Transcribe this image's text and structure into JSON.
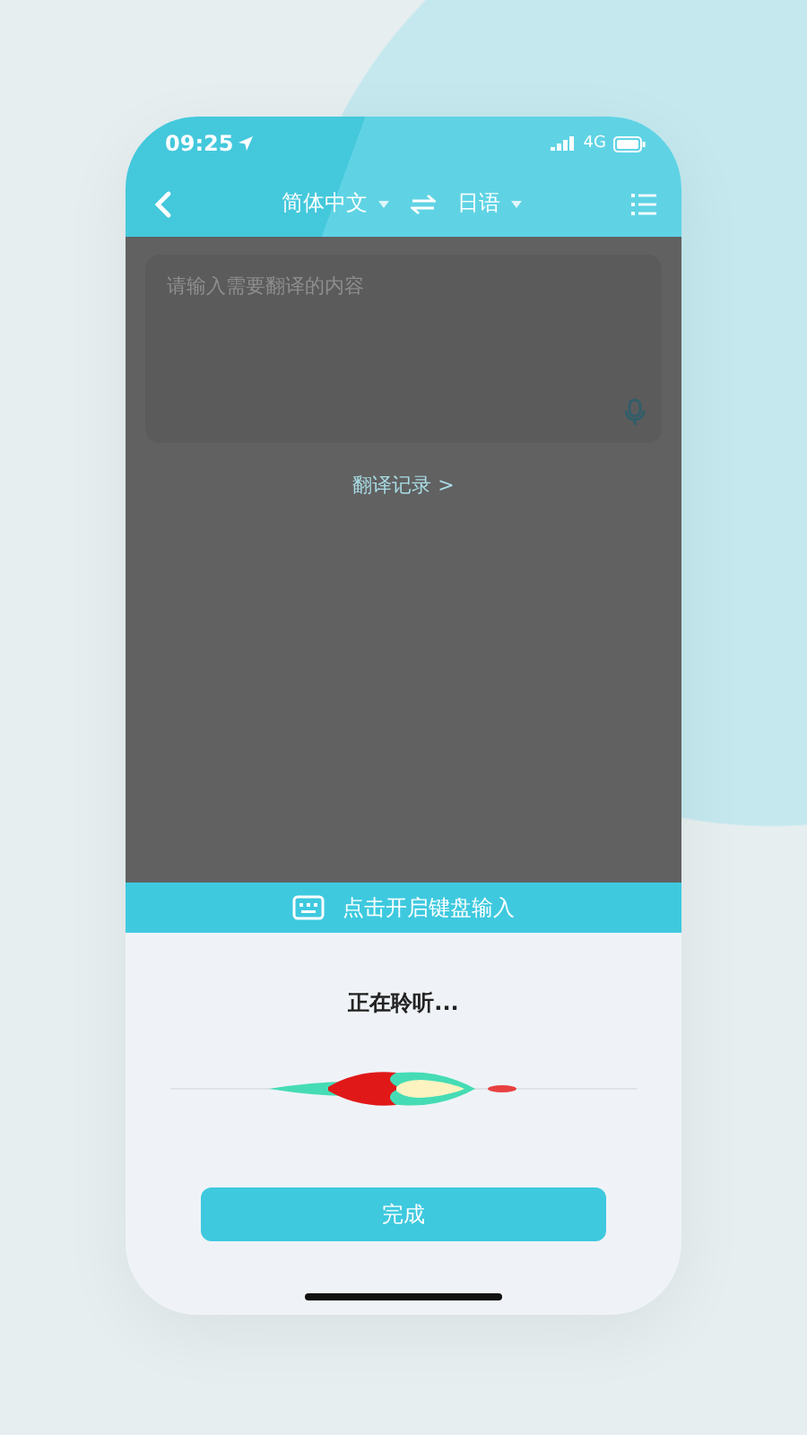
{
  "status_bar": {
    "time": "09:25",
    "network": "4G"
  },
  "nav": {
    "source_language": "简体中文",
    "target_language": "日语"
  },
  "input": {
    "placeholder": "请输入需要翻译的内容"
  },
  "history_link": "翻译记录 >",
  "keyboard_bar": {
    "label": "点击开启键盘输入"
  },
  "listening": {
    "status": "正在聆听..."
  },
  "done_button": "完成"
}
